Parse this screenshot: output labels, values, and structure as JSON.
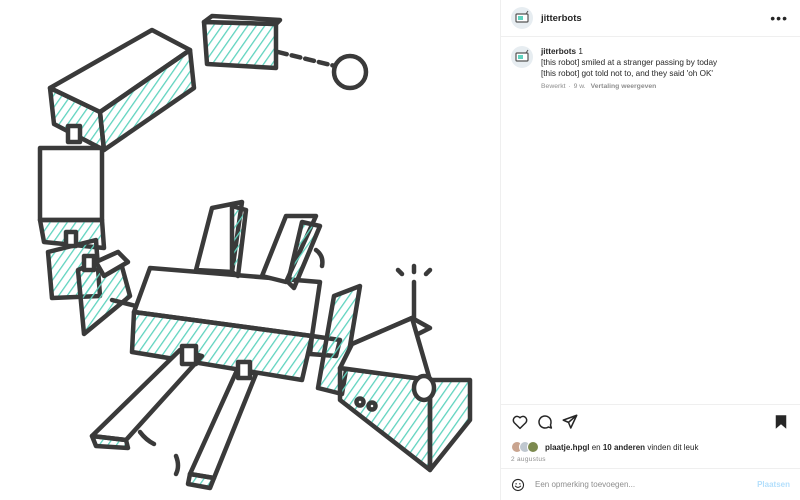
{
  "header": {
    "username": "jitterbots",
    "more_icon": "more-horizontal-icon"
  },
  "caption": {
    "username": "jitterbots",
    "title": "1",
    "lines": [
      "[this robot] smiled at a stranger passing by today",
      "[this robot] got told not to, and they said 'oh OK'"
    ],
    "edited_label": "Bewerkt",
    "age": "9 w.",
    "translate_label": "Vertaling weergeven"
  },
  "actions": {
    "icons": [
      "heart-icon",
      "comment-icon",
      "share-icon",
      "bookmark-icon"
    ]
  },
  "likes": {
    "user": "plaatje.hpgl",
    "joiner": "en",
    "others": "10 anderen",
    "suffix": "vinden dit leuk"
  },
  "date": "2 augustus",
  "comment_box": {
    "placeholder": "Een opmerking toevoegen...",
    "post_label": "Plaatsen"
  },
  "colors": {
    "accent_teal": "#5fd3bf",
    "ink": "#3a3a3a",
    "post_button": "#b3dffc",
    "meta_grey": "#8e8e8e"
  }
}
